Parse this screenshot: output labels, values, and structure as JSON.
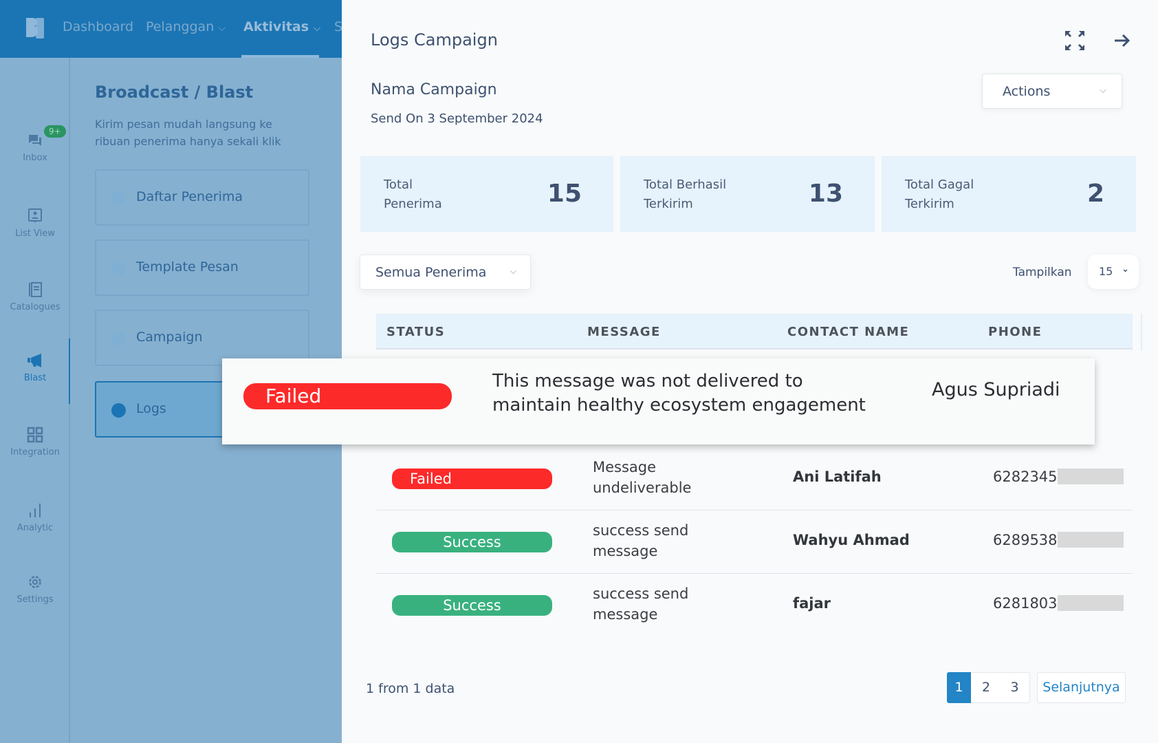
{
  "topbar": {
    "logo": "brand-logo",
    "nav": [
      {
        "label": "Dashboard",
        "dropdown": false,
        "active": false
      },
      {
        "label": "Pelanggan",
        "dropdown": true,
        "active": false
      },
      {
        "label": "Aktivitas",
        "dropdown": true,
        "active": true
      },
      {
        "label": "S",
        "dropdown": false,
        "active": false
      }
    ],
    "chevron": "⌄"
  },
  "rail": {
    "items": [
      {
        "label": "Inbox",
        "icon": "chat-bubbles-icon",
        "badge": "9+"
      },
      {
        "label": "List View",
        "icon": "contact-card-icon"
      },
      {
        "label": "Catalogues",
        "icon": "book-icon"
      },
      {
        "label": "Blast",
        "icon": "megaphone-icon",
        "active": true
      },
      {
        "label": "Integration",
        "icon": "grid-icon"
      },
      {
        "label": "Analytic",
        "icon": "bar-chart-icon"
      },
      {
        "label": "Settings",
        "icon": "gear-icon"
      }
    ]
  },
  "subpanel": {
    "title": "Broadcast / Blast",
    "description": "Kirim pesan mudah langsung ke ribuan penerima hanya sekali klik",
    "steps": [
      {
        "label": "Daftar Penerima",
        "active": false
      },
      {
        "label": "Template Pesan",
        "active": false
      },
      {
        "label": "Campaign",
        "active": false
      },
      {
        "label": "Logs",
        "active": true
      }
    ]
  },
  "panel": {
    "title": "Logs Campaign",
    "campaign_name": "Nama Campaign",
    "send_date": "Send On 3 September 2024",
    "actions_label": "Actions",
    "stats": [
      {
        "label_line1": "Total",
        "label_line2": "Penerima",
        "value": "15"
      },
      {
        "label_line1": "Total Berhasil",
        "label_line2": "Terkirim",
        "value": "13"
      },
      {
        "label_line1": "Total Gagal",
        "label_line2": "Terkirim",
        "value": "2"
      }
    ],
    "filter": {
      "selected": "Semua Penerima"
    },
    "page_size": {
      "label": "Tampilkan",
      "selected": "15"
    },
    "table": {
      "columns": [
        "STATUS",
        "MESSAGE",
        "CONTACT NAME",
        "PHONE"
      ],
      "rows": [
        {
          "status": "Failed",
          "status_type": "failed",
          "message": "Message undeliverable",
          "contact_name": "Ani Latifah",
          "phone": "6282345"
        },
        {
          "status": "Success",
          "status_type": "success",
          "message": "success send message",
          "contact_name": "Wahyu Ahmad",
          "phone": "6289538"
        },
        {
          "status": "Success",
          "status_type": "success",
          "message": "success send message",
          "contact_name": "fajar",
          "phone": "6281803"
        }
      ]
    },
    "highlight_row": {
      "status": "Failed",
      "message_line1": "This message was not delivered to",
      "message_line2": "maintain healthy ecosystem engagement",
      "contact_name": "Agus Supriadi"
    },
    "footer": {
      "summary": "1 from 1 data",
      "pages": [
        "1",
        "2",
        "3"
      ],
      "current_page": "1",
      "next_label": "Selanjutnya"
    }
  },
  "colors": {
    "brand": "#1b75b4",
    "failed": "#fd2a2a",
    "success": "#39b17f",
    "stat_bg": "#e6f2fc"
  }
}
